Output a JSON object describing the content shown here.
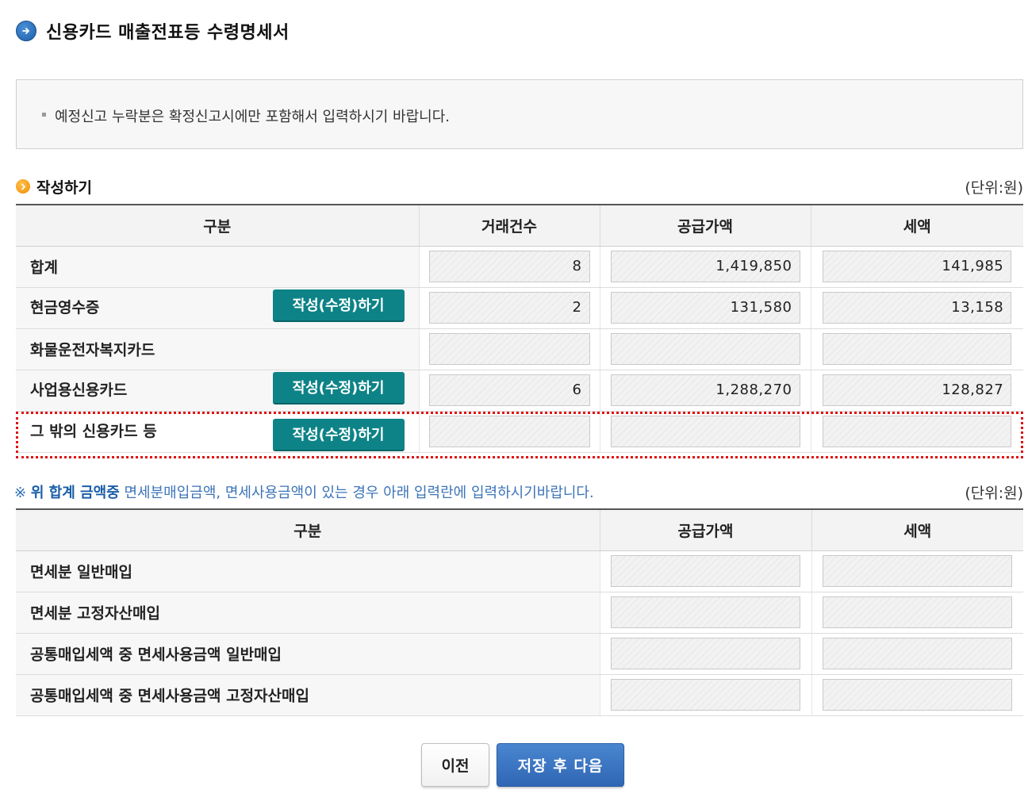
{
  "page": {
    "title": "신용카드 매출전표등 수령명세서",
    "icon": "arrow-right-circle-icon"
  },
  "notice": {
    "text": "예정신고 누락분은 확정신고시에만 포함해서 입력하시기 바랍니다."
  },
  "section": {
    "title": "작성하기",
    "unit": "(단위:원)",
    "icon": "chevron-right-circle-icon"
  },
  "table1": {
    "headers": [
      "구분",
      "거래건수",
      "공급가액",
      "세액"
    ],
    "rows": [
      {
        "label": "합계",
        "count": "8",
        "supply": "1,419,850",
        "tax": "141,985",
        "button": ""
      },
      {
        "label": "현금영수증",
        "count": "2",
        "supply": "131,580",
        "tax": "13,158",
        "button": "작성(수정)하기"
      },
      {
        "label": "화물운전자복지카드",
        "count": "",
        "supply": "",
        "tax": "",
        "button": ""
      },
      {
        "label": "사업용신용카드",
        "count": "6",
        "supply": "1,288,270",
        "tax": "128,827",
        "button": "작성(수정)하기"
      },
      {
        "label": "그 밖의 신용카드 등",
        "count": "",
        "supply": "",
        "tax": "",
        "button": "작성(수정)하기"
      }
    ]
  },
  "note": {
    "mark": "※",
    "bold": "위 합계 금액중",
    "rest": "면세분매입금액, 면세사용금액이 있는 경우 아래 입력란에 입력하시기바랍니다.",
    "unit": "(단위:원)"
  },
  "table2": {
    "headers": [
      "구분",
      "공급가액",
      "세액"
    ],
    "rows": [
      {
        "label": "면세분 일반매입",
        "supply": "",
        "tax": ""
      },
      {
        "label": "면세분 고정자산매입",
        "supply": "",
        "tax": ""
      },
      {
        "label": "공통매입세액 중 면세사용금액 일반매입",
        "supply": "",
        "tax": ""
      },
      {
        "label": "공통매입세액 중 면세사용금액 고정자산매입",
        "supply": "",
        "tax": ""
      }
    ]
  },
  "buttons": {
    "prev": "이전",
    "next": "저장 후 다음"
  },
  "colors": {
    "edit_button": "#0d8387",
    "next_button": "#2f66b4",
    "highlight_border": "#e01010"
  }
}
